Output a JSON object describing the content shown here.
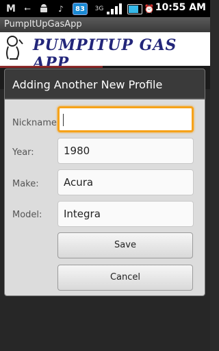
{
  "status_bar": {
    "notif_badge": "83",
    "network": "3G",
    "time": "10:55 AM"
  },
  "app": {
    "title": "PumpItUpGasApp",
    "banner_text": "PUMPITUP GAS APP"
  },
  "dialog": {
    "title": "Adding Another New Profile",
    "fields": [
      {
        "label": "Nickname:",
        "value": ""
      },
      {
        "label": "Year:",
        "value": "1980"
      },
      {
        "label": "Make:",
        "value": "Acura"
      },
      {
        "label": "Model:",
        "value": "Integra"
      }
    ],
    "save_label": "Save",
    "cancel_label": "Cancel"
  }
}
